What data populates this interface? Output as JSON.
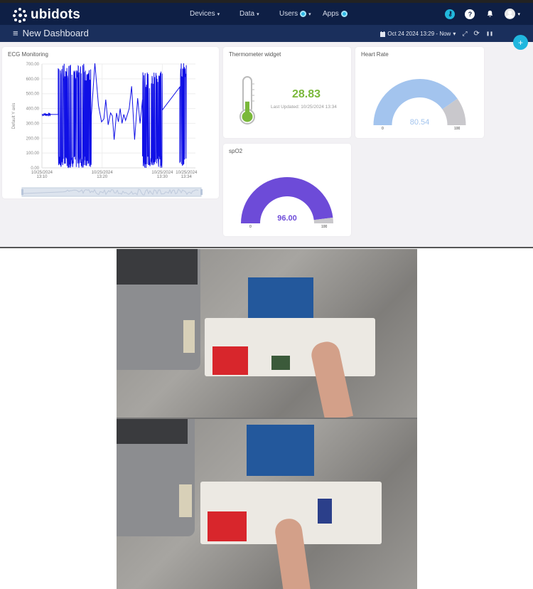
{
  "nav": {
    "brand": "ubidots",
    "items": [
      {
        "label": "Devices",
        "caret": "▾"
      },
      {
        "label": "Data",
        "caret": "▾"
      },
      {
        "label": "Users",
        "caret": "▾",
        "badge": true
      },
      {
        "label": "Apps",
        "badge": true
      }
    ],
    "icons": {
      "key": "key-icon",
      "help": "?",
      "bell": "🔔",
      "avatar_caret": "▾"
    }
  },
  "subbar": {
    "menu_icon": "≡",
    "title": "New Dashboard",
    "date_range": "Oct 24 2024 13:29 - Now",
    "range_caret": "▾",
    "expand_icon": "⤢",
    "refresh_icon": "⟳",
    "pause_icon": "❚❚"
  },
  "fab": {
    "label": "+"
  },
  "widgets": {
    "ecg": {
      "title": "ECG Monitoring"
    },
    "thermometer": {
      "title": "Thermometer widget",
      "value": "28.83",
      "updated": "Last Updated: 10/25/2024 13:34",
      "fill_fraction": 0.4,
      "color": "#7ab83a"
    },
    "heart_rate": {
      "title": "Heart Rate",
      "value": "80.54",
      "min": "0",
      "max": "100",
      "color": "#a3c4ee",
      "track": "#c9c8cc"
    },
    "spo2": {
      "title": "spO2",
      "value": "96.00",
      "min": "0",
      "max": "100",
      "color": "#6d4bd8",
      "track": "#c9c8cc"
    }
  },
  "chart_data": {
    "type": "line",
    "title": "ECG Monitoring",
    "ylabel": "Default Y axis",
    "xlabel": "",
    "ylim": [
      0,
      700
    ],
    "yticks": [
      "0.00",
      "100.00",
      "200.00",
      "300.00",
      "400.00",
      "500.00",
      "600.00",
      "700.00"
    ],
    "xticks": [
      {
        "date": "10/25/2024",
        "time": "13:10",
        "t": 0
      },
      {
        "date": "10/25/2024",
        "time": "13:20",
        "t": 10
      },
      {
        "date": "10/25/2024",
        "time": "13:30",
        "t": 20
      },
      {
        "date": "10/25/2024",
        "time": "13:34",
        "t": 24
      }
    ],
    "xlim": [
      0,
      25.5
    ],
    "grid": true,
    "color": "#1010e6",
    "segments": [
      {
        "t0": 0,
        "t1": 2.7,
        "kind": "flat",
        "level": 360
      },
      {
        "t0": 2.7,
        "t1": 8.2,
        "kind": "dense",
        "lo": 0,
        "hi": 705
      },
      {
        "kind": "points",
        "pts": [
          [
            8.2,
            350
          ],
          [
            8.8,
            705
          ],
          [
            9.4,
            420
          ],
          [
            9.9,
            310
          ],
          [
            10.3,
            330
          ],
          [
            10.6,
            460
          ],
          [
            11,
            290
          ],
          [
            11.4,
            370
          ],
          [
            11.7,
            350
          ],
          [
            12,
            190
          ],
          [
            12.4,
            370
          ],
          [
            12.7,
            310
          ],
          [
            13,
            400
          ],
          [
            13.3,
            300
          ],
          [
            13.6,
            360
          ],
          [
            13.9,
            320
          ],
          [
            14.5,
            400
          ],
          [
            14.9,
            550
          ],
          [
            15.4,
            190
          ],
          [
            15.9,
            470
          ],
          [
            16.3,
            300
          ],
          [
            16.7,
            460
          ]
        ]
      },
      {
        "t0": 16.7,
        "t1": 20,
        "kind": "dense",
        "lo": 0,
        "hi": 650
      },
      {
        "kind": "points",
        "pts": [
          [
            20,
            390
          ],
          [
            22.9,
            545
          ]
        ]
      },
      {
        "t0": 22.9,
        "t1": 24,
        "kind": "dense",
        "lo": 0,
        "hi": 705
      }
    ]
  },
  "photos": [
    {
      "caption": "Breadboard circuit with sensors, finger on temperature sensor"
    },
    {
      "caption": "Breadboard circuit with sensors, finger on pulse oximeter sensor"
    }
  ]
}
